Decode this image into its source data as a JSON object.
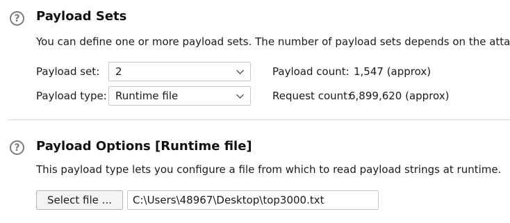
{
  "payload_sets": {
    "title": "Payload Sets",
    "description": "You can define one or more payload sets. The number of payload sets depends on the attack t",
    "payload_set_label": "Payload set:",
    "payload_set_value": "2",
    "payload_type_label": "Payload type:",
    "payload_type_value": "Runtime file",
    "payload_count_label": "Payload count:",
    "payload_count_value": "1,547 (approx)",
    "request_count_label": "Request count:",
    "request_count_value": "6,899,620 (approx)"
  },
  "payload_options": {
    "title": "Payload Options [Runtime file]",
    "description": "This payload type lets you configure a file from which to read payload strings at runtime.",
    "select_file_label": "Select file ...",
    "file_path_value": "C:\\Users\\48967\\Desktop\\top3000.txt"
  },
  "icons": {
    "help": "question-circle-icon",
    "dropdown": "chevron-down-icon"
  }
}
